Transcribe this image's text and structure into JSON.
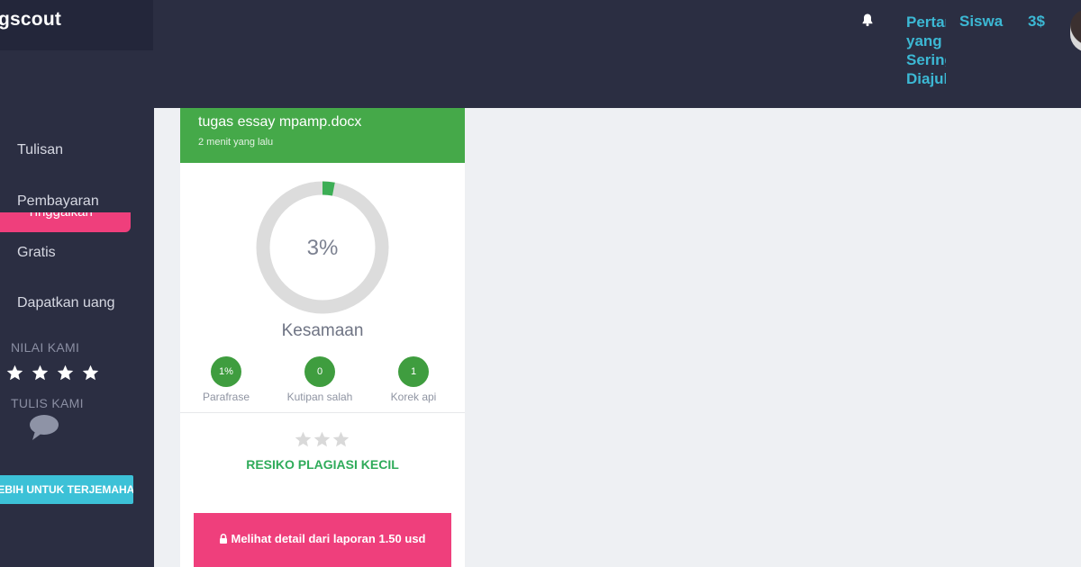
{
  "header": {
    "logo": "gscout",
    "faq_label": "Pertanyaan yang Sering Diajukan",
    "role_label": "Siswa",
    "balance": "3$"
  },
  "sidebar": {
    "active_item": "Tinggalkan",
    "items": [
      {
        "label": "Tulisan"
      },
      {
        "label": "Pembayaran"
      },
      {
        "label": "Gratis"
      },
      {
        "label": "Dapatkan uang"
      }
    ],
    "rate_heading": "NILAI KAMI",
    "write_heading": "TULIS KAMI",
    "cta_label": "LEBIH UNTUK TERJEMAHANA",
    "rating_stars": 4
  },
  "report": {
    "file_name": "tugas essay mpamp.docx",
    "uploaded": "2 menit yang lalu",
    "similarity_percent": "3%",
    "similarity_fraction": 0.03,
    "similarity_label": "Kesamaan",
    "stats": [
      {
        "value": "1%",
        "label": "Parafrase"
      },
      {
        "value": "0",
        "label": "Kutipan salah"
      },
      {
        "value": "1",
        "label": "Korek api"
      }
    ],
    "risk_label": "RESIKO PLAGIASI KECIL",
    "detail_button": "Melihat detail dari laporan 1.50 usd"
  },
  "colors": {
    "topbar": "#2b2e42",
    "accent_pink": "#ef3f7c",
    "accent_cyan": "#3cc1d7",
    "card_header_green": "#45a949",
    "risk_green": "#2fab5a"
  }
}
